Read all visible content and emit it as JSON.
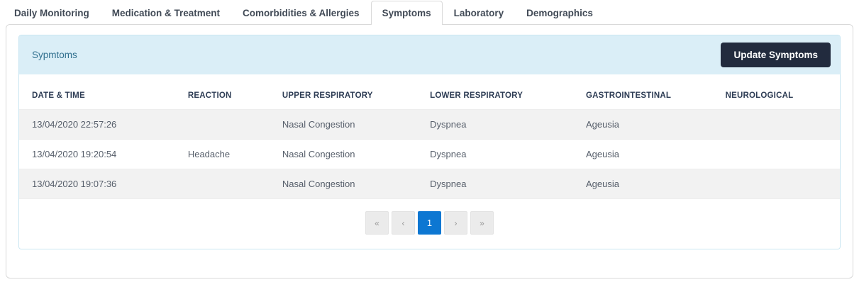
{
  "tabs": {
    "items": [
      {
        "label": "Daily Monitoring",
        "active": false
      },
      {
        "label": "Medication & Treatment",
        "active": false
      },
      {
        "label": "Comorbidities & Allergies",
        "active": false
      },
      {
        "label": "Symptoms",
        "active": true
      },
      {
        "label": "Laboratory",
        "active": false
      },
      {
        "label": "Demographics",
        "active": false
      }
    ]
  },
  "panel": {
    "title": "Sypmtoms",
    "update_button_label": "Update Symptoms"
  },
  "table": {
    "headers": [
      "DATE & TIME",
      "REACTION",
      "UPPER RESPIRATORY",
      "LOWER RESPIRATORY",
      "GASTROINTESTINAL",
      "NEUROLOGICAL"
    ],
    "rows": [
      {
        "cells": [
          "13/04/2020 22:57:26",
          "",
          "Nasal Congestion",
          "Dyspnea",
          "Ageusia",
          ""
        ]
      },
      {
        "cells": [
          "13/04/2020 19:20:54",
          "Headache",
          "Nasal Congestion",
          "Dyspnea",
          "Ageusia",
          ""
        ]
      },
      {
        "cells": [
          "13/04/2020 19:07:36",
          "",
          "Nasal Congestion",
          "Dyspnea",
          "Ageusia",
          ""
        ]
      }
    ]
  },
  "pagination": {
    "first_label": "«",
    "prev_label": "‹",
    "current_page": "1",
    "next_label": "›",
    "last_label": "»"
  },
  "colors": {
    "accent_blue": "#0d77d2",
    "panel_heading_bg": "#daeef7",
    "panel_border": "#c9e6f2",
    "panel_title_text": "#31708f",
    "update_button_bg": "#222b3e",
    "row_stripe_bg": "#f2f2f2"
  }
}
